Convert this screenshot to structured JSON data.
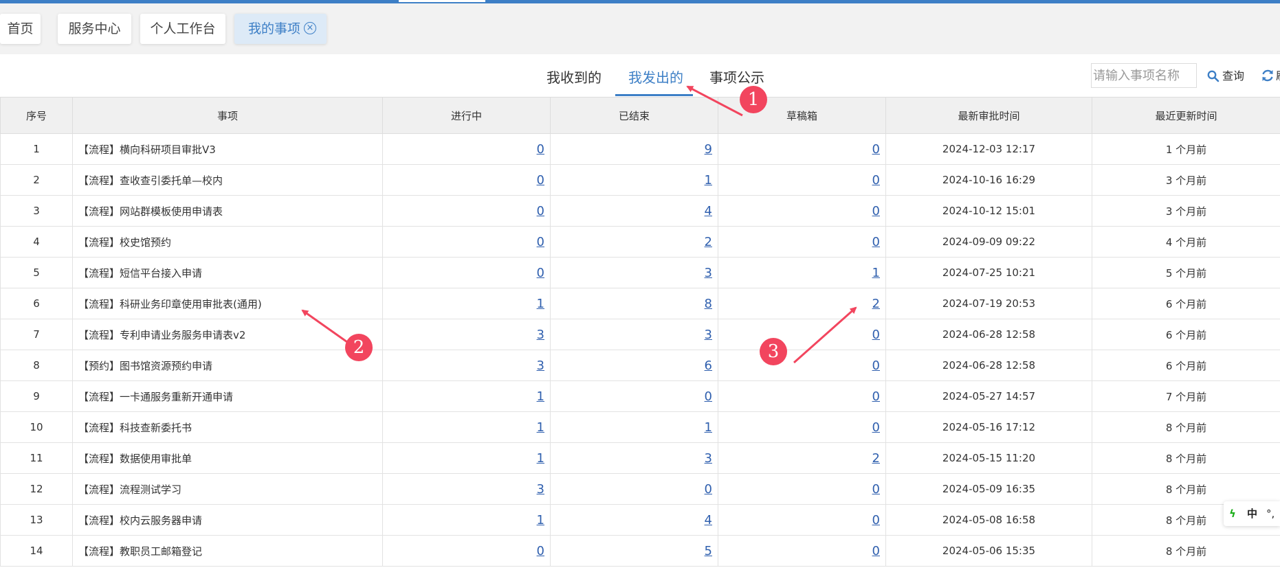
{
  "tabs": [
    {
      "label": "首页"
    },
    {
      "label": "服务中心"
    },
    {
      "label": "个人工作台"
    },
    {
      "label": "我的事项",
      "active": true
    }
  ],
  "subtabs": [
    {
      "label": "我收到的"
    },
    {
      "label": "我发出的",
      "active": true
    },
    {
      "label": "事项公示"
    }
  ],
  "search": {
    "placeholder": "请输入事项名称",
    "button_label": "查询",
    "refresh_label": "刷"
  },
  "columns": [
    "序号",
    "事项",
    "进行中",
    "已结束",
    "草稿箱",
    "最新审批时间",
    "最近更新时间"
  ],
  "rows": [
    {
      "seq": "1",
      "name": "【流程】横向科研项目审批V3",
      "inprogress": "0",
      "finished": "9",
      "draft": "0",
      "latest": "2024-12-03 12:17",
      "updated": "1 个月前"
    },
    {
      "seq": "2",
      "name": "【流程】查收查引委托单—校内",
      "inprogress": "0",
      "finished": "1",
      "draft": "0",
      "latest": "2024-10-16 16:29",
      "updated": "3 个月前"
    },
    {
      "seq": "3",
      "name": "【流程】网站群模板使用申请表",
      "inprogress": "0",
      "finished": "4",
      "draft": "0",
      "latest": "2024-10-12 15:01",
      "updated": "3 个月前"
    },
    {
      "seq": "4",
      "name": "【流程】校史馆预约",
      "inprogress": "0",
      "finished": "2",
      "draft": "0",
      "latest": "2024-09-09 09:22",
      "updated": "4 个月前"
    },
    {
      "seq": "5",
      "name": "【流程】短信平台接入申请",
      "inprogress": "0",
      "finished": "3",
      "draft": "1",
      "latest": "2024-07-25 10:21",
      "updated": "5 个月前"
    },
    {
      "seq": "6",
      "name": "【流程】科研业务印章使用审批表(通用)",
      "inprogress": "1",
      "finished": "8",
      "draft": "2",
      "latest": "2024-07-19 20:53",
      "updated": "6 个月前"
    },
    {
      "seq": "7",
      "name": "【流程】专利申请业务服务申请表v2",
      "inprogress": "3",
      "finished": "3",
      "draft": "0",
      "latest": "2024-06-28 12:58",
      "updated": "6 个月前"
    },
    {
      "seq": "8",
      "name": "【预约】图书馆资源预约申请",
      "inprogress": "3",
      "finished": "6",
      "draft": "0",
      "latest": "2024-06-28 12:58",
      "updated": "6 个月前"
    },
    {
      "seq": "9",
      "name": "【流程】一卡通服务重新开通申请",
      "inprogress": "1",
      "finished": "0",
      "draft": "0",
      "latest": "2024-05-27 14:57",
      "updated": "7 个月前"
    },
    {
      "seq": "10",
      "name": "【流程】科技查新委托书",
      "inprogress": "1",
      "finished": "1",
      "draft": "0",
      "latest": "2024-05-16 17:12",
      "updated": "8 个月前"
    },
    {
      "seq": "11",
      "name": "【流程】数据使用审批单",
      "inprogress": "1",
      "finished": "3",
      "draft": "2",
      "latest": "2024-05-15 11:20",
      "updated": "8 个月前"
    },
    {
      "seq": "12",
      "name": "【流程】流程测试学习",
      "inprogress": "3",
      "finished": "0",
      "draft": "0",
      "latest": "2024-05-09 16:35",
      "updated": "8 个月前"
    },
    {
      "seq": "13",
      "name": "【流程】校内云服务器申请",
      "inprogress": "1",
      "finished": "4",
      "draft": "0",
      "latest": "2024-05-08 16:58",
      "updated": "8 个月前"
    },
    {
      "seq": "14",
      "name": "【流程】教职员工邮箱登记",
      "inprogress": "0",
      "finished": "5",
      "draft": "0",
      "latest": "2024-05-06 15:35",
      "updated": "8 个月前"
    }
  ],
  "markers": [
    {
      "label": "1"
    },
    {
      "label": "2"
    },
    {
      "label": "3"
    }
  ],
  "ime": {
    "mode": "中",
    "punct": "°,"
  },
  "colors": {
    "accent": "#3d7fc6",
    "marker": "#f2455e",
    "link": "#2f5fae"
  }
}
